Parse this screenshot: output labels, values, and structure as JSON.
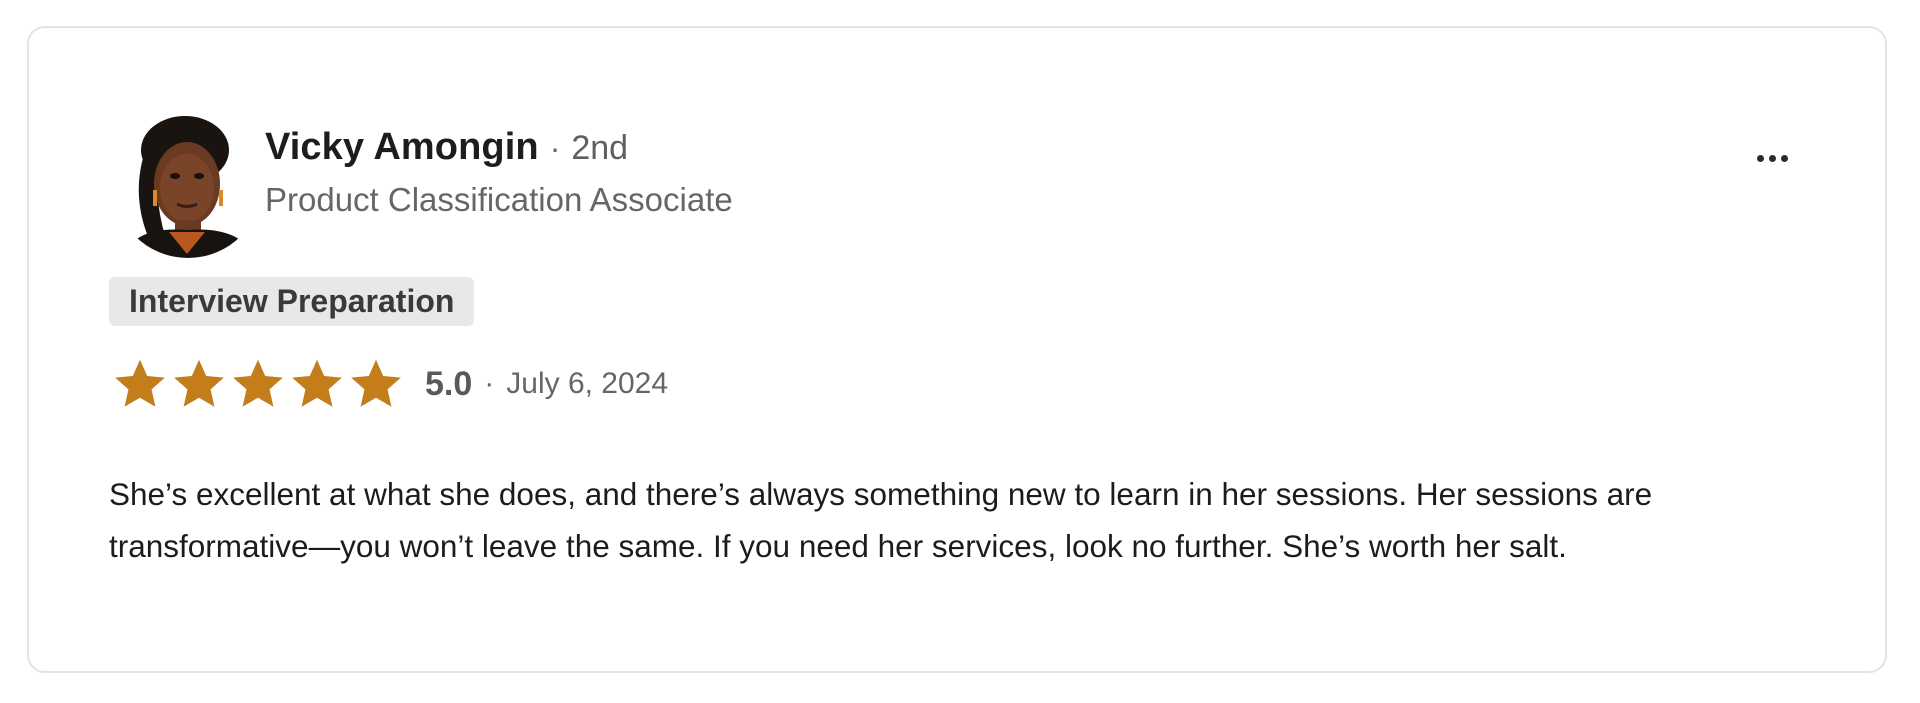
{
  "review": {
    "reviewer": {
      "name": "Vicky Amongin",
      "separator": "·",
      "connection_degree": "2nd",
      "headline": "Product Classification Associate",
      "avatar_icon": "reviewer-photo"
    },
    "menu": {
      "icon": "more-horizontal-icon"
    },
    "tag": "Interview Preparation",
    "rating": {
      "stars": 5,
      "max_stars": 5,
      "score_label": "5.0",
      "separator": "·",
      "date": "July 6, 2024",
      "star_color": "#c37d1b"
    },
    "text": "She’s excellent at what she does, and there’s always something new to learn in her sessions. Her sessions are transformative—you won’t leave the same. If you need her services, look no further. She’s worth her salt."
  }
}
